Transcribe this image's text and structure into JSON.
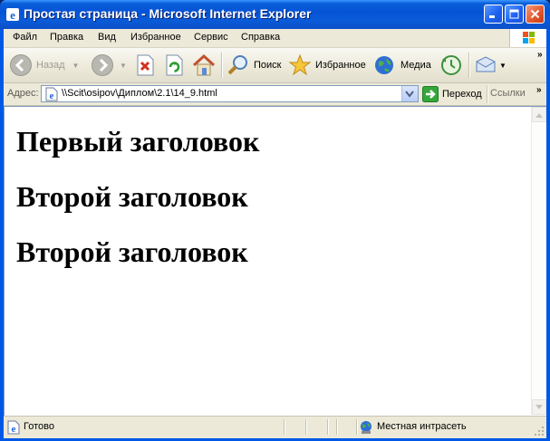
{
  "window": {
    "title": "Простая страница - Microsoft Internet Explorer"
  },
  "menu": [
    {
      "label": "Файл"
    },
    {
      "label": "Правка"
    },
    {
      "label": "Вид"
    },
    {
      "label": "Избранное"
    },
    {
      "label": "Сервис"
    },
    {
      "label": "Справка"
    }
  ],
  "toolbar": {
    "back_label": "Назад",
    "search_label": "Поиск",
    "favorites_label": "Избранное",
    "media_label": "Медиа"
  },
  "address": {
    "label": "Адрес:",
    "value": "\\\\Scit\\osipov\\Диплом\\2.1\\14_9.html",
    "go_label": "Переход",
    "links_label": "Ссылки"
  },
  "page": {
    "headings": [
      "Первый заголовок",
      "Второй заголовок",
      "Второй заголовок"
    ]
  },
  "status": {
    "text": "Готово",
    "zone": "Местная интрасеть"
  },
  "colors": {
    "titlebar": "#0553d6",
    "chrome": "#ece9d8",
    "address_border": "#7f9db9"
  }
}
